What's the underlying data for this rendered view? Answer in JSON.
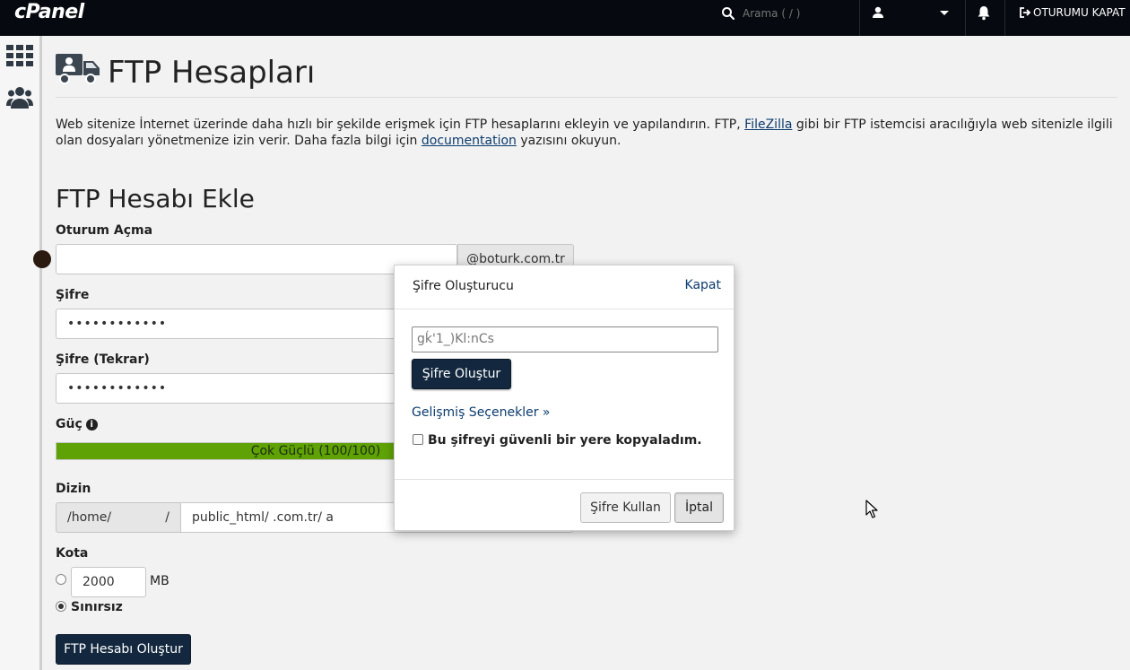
{
  "header": {
    "logo": "cPanel",
    "search_placeholder": "Arama ( / )",
    "logout_label": "OTURUMU KAPAT"
  },
  "sidebar": {
    "items": [
      {
        "icon": "grid-icon"
      },
      {
        "icon": "users-icon"
      }
    ]
  },
  "page": {
    "title": "FTP Hesapları",
    "intro_part1": "Web sitenize İnternet üzerinde daha hızlı bir şekilde erişmek için FTP hesaplarını ekleyin ve yapılandırın. FTP, ",
    "intro_link_filezilla": "FileZilla",
    "intro_part2": " gibi bir FTP istemcisi aracılığıyla web sitenizle ilgili olan dosyaları yönetmenize izin verir. Daha fazla bilgi için ",
    "intro_link_docs": "documentation",
    "intro_part3": " yazısını okuyun."
  },
  "form": {
    "section_title": "FTP Hesabı Ekle",
    "login_label": "Oturum Açma",
    "login_value": "",
    "domain_suffix": "@boturk.com.tr",
    "password_label": "Şifre",
    "password_value": "••••••••••••",
    "password_repeat_label": "Şifre (Tekrar)",
    "password_repeat_value": "••••••••••••",
    "strength_label": "Güç",
    "strength_text": "Çok Güçlü (100/100)",
    "strength_percent": 100,
    "directory_label": "Dizin",
    "directory_prefix": "/home/",
    "directory_prefix_slash": "/",
    "directory_value": "public_html/          .com.tr/          a",
    "quota_label": "Kota",
    "quota_value": "2000",
    "quota_unit": "MB",
    "unlimited_label": "Sınırsız",
    "unlimited_selected": true,
    "submit_label": "FTP Hesabı Oluştur"
  },
  "modal": {
    "title": "Şifre Oluşturucu",
    "close_label": "Kapat",
    "generated_value": "gḱ'1_)Kl:nCs",
    "generate_label": "Şifre Oluştur",
    "advanced_label": "Gelişmiş Seçenekler »",
    "copied_label": "Bu şifreyi güvenli bir yere kopyaladım.",
    "copied_checked": false,
    "use_label": "Şifre Kullan",
    "cancel_label": "İptal"
  },
  "colors": {
    "topbar": "#060a10",
    "primary_button": "#13283f",
    "strength_fill": "#5fa206",
    "link": "#0b3b6e"
  }
}
